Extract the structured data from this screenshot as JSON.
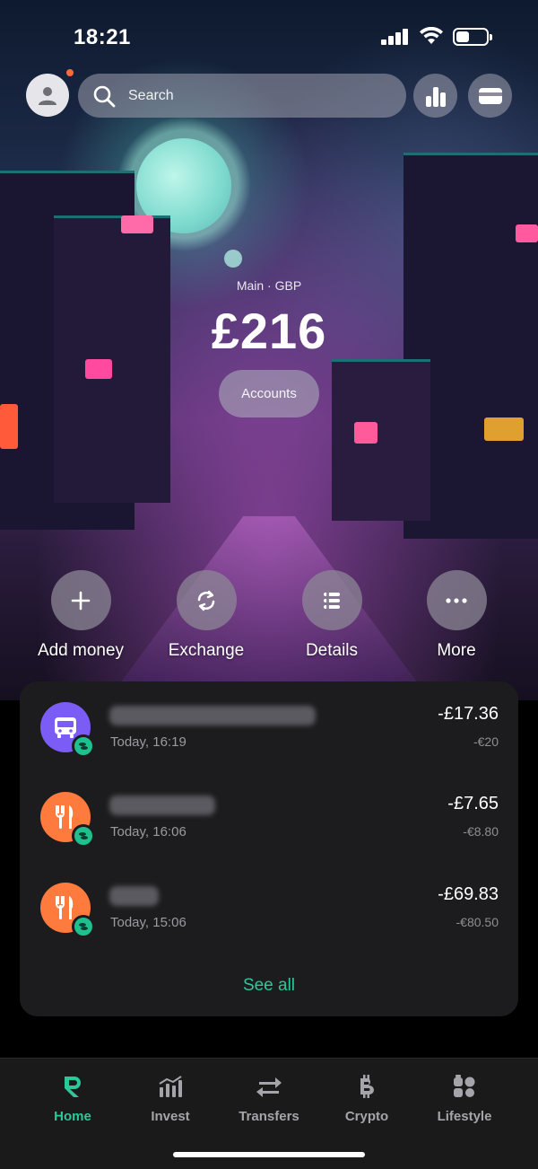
{
  "status_bar": {
    "time": "18:21"
  },
  "search": {
    "placeholder": "Search"
  },
  "account": {
    "name": "Main · GBP",
    "balance": "£216",
    "accounts_label": "Accounts"
  },
  "actions": [
    {
      "label": "Add money",
      "icon": "plus-icon"
    },
    {
      "label": "Exchange",
      "icon": "exchange-icon"
    },
    {
      "label": "Details",
      "icon": "details-icon"
    },
    {
      "label": "More",
      "icon": "more-icon"
    }
  ],
  "transactions": [
    {
      "time": "Today, 16:19",
      "amount": "-£17.36",
      "original_amount": "-€20",
      "icon": "bus-icon",
      "icon_color": "#7b5cf5"
    },
    {
      "time": "Today, 16:06",
      "amount": "-£7.65",
      "original_amount": "-€8.80",
      "icon": "fork-knife-icon",
      "icon_color": "#ff7a3d"
    },
    {
      "time": "Today, 15:06",
      "amount": "-£69.83",
      "original_amount": "-€80.50",
      "icon": "fork-knife-icon",
      "icon_color": "#ff7a3d"
    }
  ],
  "see_all": "See all",
  "nav": [
    {
      "label": "Home",
      "icon": "revolut-r-icon",
      "active": true
    },
    {
      "label": "Invest",
      "icon": "invest-chart-icon",
      "active": false
    },
    {
      "label": "Transfers",
      "icon": "transfers-arrows-icon",
      "active": false
    },
    {
      "label": "Crypto",
      "icon": "bitcoin-icon",
      "active": false
    },
    {
      "label": "Lifestyle",
      "icon": "lifestyle-icon",
      "active": false
    }
  ],
  "colors": {
    "accent": "#2cc89a",
    "card_bg": "#1c1c1e",
    "nav_bg": "#1a1a1a"
  }
}
